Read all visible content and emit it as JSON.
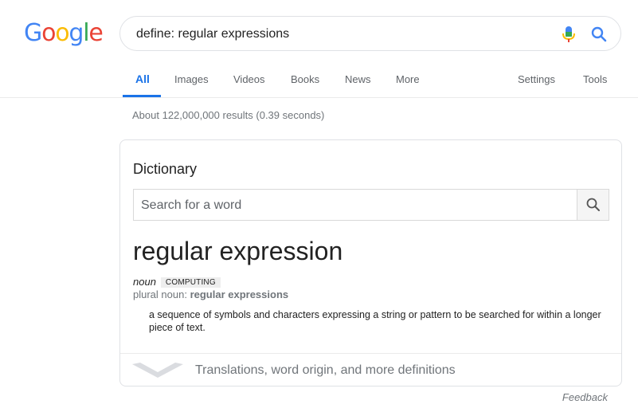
{
  "logo": {
    "letters": [
      "G",
      "o",
      "o",
      "g",
      "l",
      "e"
    ],
    "colors": [
      "#4285F4",
      "#EA4335",
      "#FBBC05",
      "#4285F4",
      "#34A853",
      "#EA4335"
    ]
  },
  "search": {
    "query": "define: regular expressions",
    "icons": [
      "mic-icon",
      "search-icon"
    ]
  },
  "tabs": {
    "items": [
      "All",
      "Images",
      "Videos",
      "Books",
      "News",
      "More"
    ],
    "active": "All",
    "settings": "Settings",
    "tools": "Tools",
    "accent": "#1a73e8"
  },
  "result_stats": "About 122,000,000 results (0.39 seconds)",
  "dictionary": {
    "title": "Dictionary",
    "search_placeholder": "Search for a word",
    "word": "regular expression",
    "part_of_speech": "noun",
    "label": "COMPUTING",
    "plural_prefix": "plural noun: ",
    "plural_word": "regular expressions",
    "definition": "a sequence of symbols and characters expressing a string or pattern to be searched for within a longer piece of text.",
    "more_link": "Translations, word origin, and more definitions"
  },
  "feedback": "Feedback"
}
